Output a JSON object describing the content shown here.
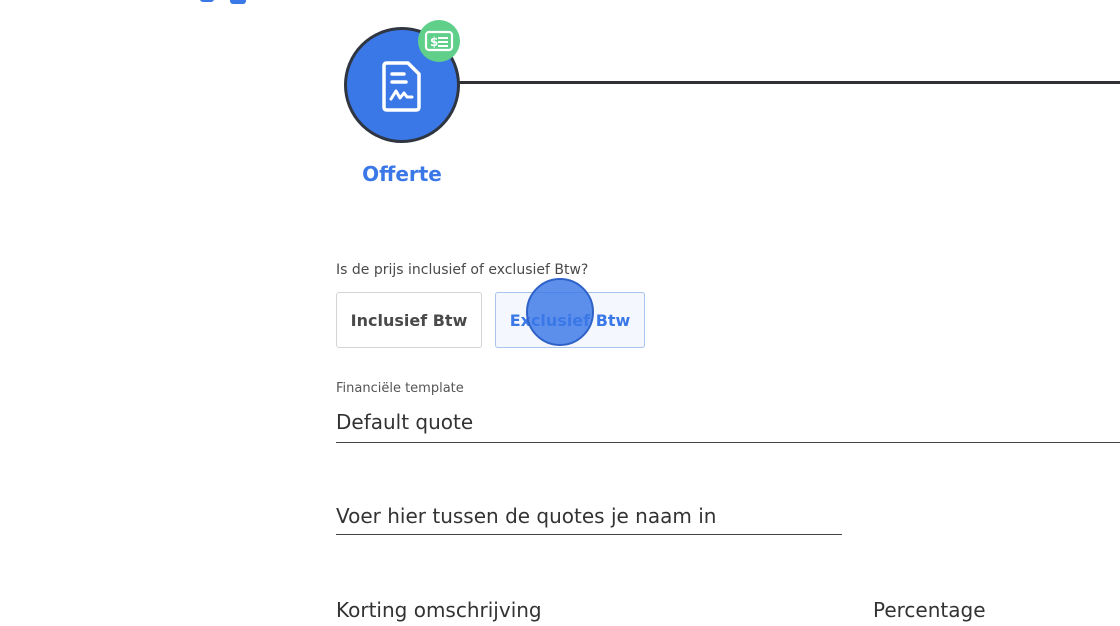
{
  "colors": {
    "accent": "#3b78e7",
    "badge": "#5fcf8a",
    "text": "#333333",
    "step_line": "#2f3136"
  },
  "step": {
    "label": "Offerte",
    "icon": "signed-document-icon",
    "badge_icon": "money-bill-icon"
  },
  "vat": {
    "question": "Is de prijs inclusief of exclusief Btw?",
    "options": [
      "Inclusief Btw",
      "Exclusief Btw"
    ],
    "selected": "Exclusief Btw"
  },
  "financial_template": {
    "label": "Financiële template",
    "value": "Default quote"
  },
  "name_field": {
    "placeholder": "Voer hier tussen de quotes je naam in"
  },
  "discount": {
    "description_label": "Korting omschrijving",
    "percentage_label": "Percentage"
  }
}
